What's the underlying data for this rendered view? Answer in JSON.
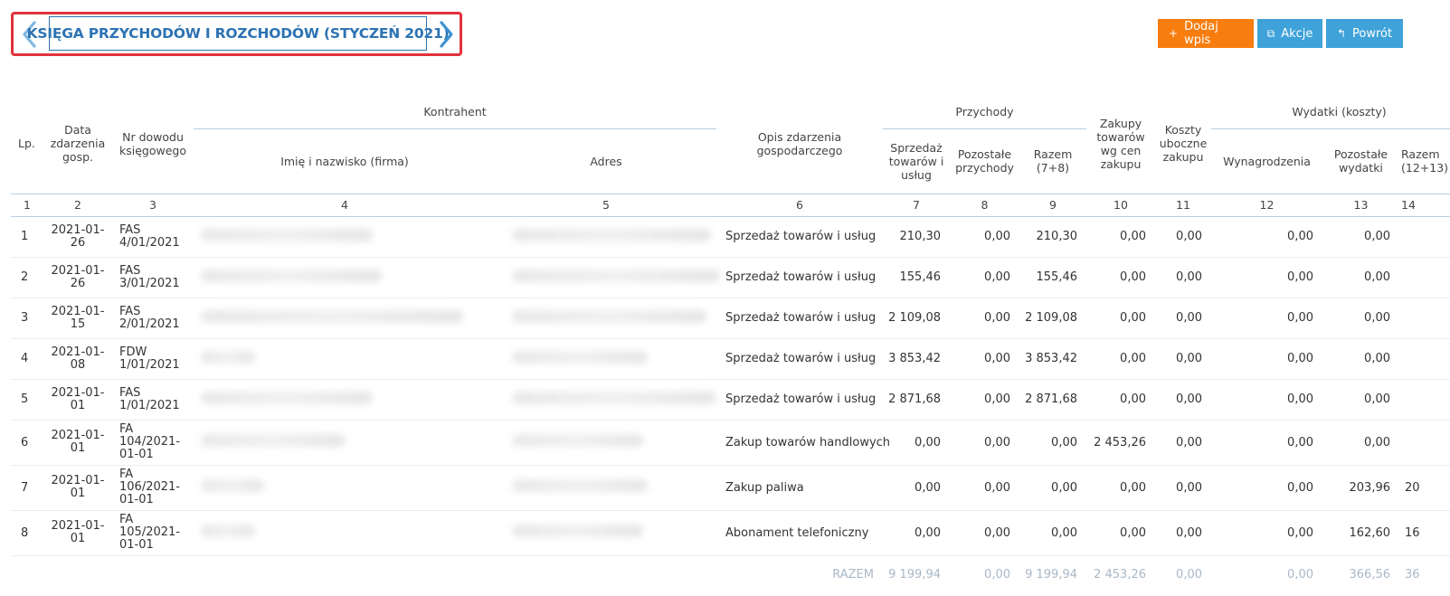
{
  "header": {
    "title": "KSIĘGA PRZYCHODÓW I ROZCHODÓW (STYCZEŃ 2021)",
    "prev_icon": "chevron-left-icon",
    "next_icon": "chevron-right-icon",
    "highlight_color": "#e2323c",
    "accent_color": "#2d73b3"
  },
  "toolbar": {
    "add_label": "Dodaj wpis",
    "actions_label": "Akcje",
    "back_label": "Powrót",
    "add_color": "#f77d0f",
    "secondary_color": "#3fa2d9"
  },
  "table": {
    "headers": {
      "lp": "Lp.",
      "date": "Data zdarzenia gosp.",
      "doc": "Nr dowodu księgowego",
      "contractor": "Kontrahent",
      "name": "Imię i nazwisko (firma)",
      "address": "Adres",
      "desc": "Opis zdarzenia gospodarczego",
      "income": "Przychody",
      "sales": "Sprzedaż towarów i usług",
      "other_income": "Pozostałe przychody",
      "total_income": "Razem (7+8)",
      "purchases": "Zakupy towarów wg cen zakupu",
      "side_costs": "Koszty uboczne zakupu",
      "expenses": "Wydatki (koszty)",
      "salaries": "Wynagrodzenia",
      "other_expenses": "Pozostałe wydatki",
      "total_expenses": "Razem (12+13)"
    },
    "column_numbers": [
      "1",
      "2",
      "3",
      "4",
      "5",
      "6",
      "7",
      "8",
      "9",
      "10",
      "11",
      "12",
      "13",
      "14"
    ],
    "rows": [
      {
        "lp": "1",
        "date": "2021-01-26",
        "doc": "FAS 4/01/2021",
        "desc": "Sprzedaż towarów i usług",
        "c7": "210,30",
        "c8": "0,00",
        "c9": "210,30",
        "c10": "0,00",
        "c11": "0,00",
        "c12": "0,00",
        "c13": "0,00",
        "c14": ""
      },
      {
        "lp": "2",
        "date": "2021-01-26",
        "doc": "FAS 3/01/2021",
        "desc": "Sprzedaż towarów i usług",
        "c7": "155,46",
        "c8": "0,00",
        "c9": "155,46",
        "c10": "0,00",
        "c11": "0,00",
        "c12": "0,00",
        "c13": "0,00",
        "c14": ""
      },
      {
        "lp": "3",
        "date": "2021-01-15",
        "doc": "FAS 2/01/2021",
        "desc": "Sprzedaż towarów i usług",
        "c7": "2 109,08",
        "c8": "0,00",
        "c9": "2 109,08",
        "c10": "0,00",
        "c11": "0,00",
        "c12": "0,00",
        "c13": "0,00",
        "c14": ""
      },
      {
        "lp": "4",
        "date": "2021-01-08",
        "doc": "FDW 1/01/2021",
        "desc": "Sprzedaż towarów i usług",
        "c7": "3 853,42",
        "c8": "0,00",
        "c9": "3 853,42",
        "c10": "0,00",
        "c11": "0,00",
        "c12": "0,00",
        "c13": "0,00",
        "c14": ""
      },
      {
        "lp": "5",
        "date": "2021-01-01",
        "doc": "FAS 1/01/2021",
        "desc": "Sprzedaż towarów i usług",
        "c7": "2 871,68",
        "c8": "0,00",
        "c9": "2 871,68",
        "c10": "0,00",
        "c11": "0,00",
        "c12": "0,00",
        "c13": "0,00",
        "c14": ""
      },
      {
        "lp": "6",
        "date": "2021-01-01",
        "doc": "FA 104/2021-01-01",
        "desc": "Zakup towarów handlowych",
        "c7": "0,00",
        "c8": "0,00",
        "c9": "0,00",
        "c10": "2 453,26",
        "c11": "0,00",
        "c12": "0,00",
        "c13": "0,00",
        "c14": ""
      },
      {
        "lp": "7",
        "date": "2021-01-01",
        "doc": "FA 106/2021-01-01",
        "desc": "Zakup paliwa",
        "c7": "0,00",
        "c8": "0,00",
        "c9": "0,00",
        "c10": "0,00",
        "c11": "0,00",
        "c12": "0,00",
        "c13": "203,96",
        "c14": "20"
      },
      {
        "lp": "8",
        "date": "2021-01-01",
        "doc": "FA 105/2021-01-01",
        "desc": "Abonament telefoniczny",
        "c7": "0,00",
        "c8": "0,00",
        "c9": "0,00",
        "c10": "0,00",
        "c11": "0,00",
        "c12": "0,00",
        "c13": "162,60",
        "c14": "16"
      }
    ],
    "totals": {
      "label": "RAZEM",
      "c7": "9 199,94",
      "c8": "0,00",
      "c9": "9 199,94",
      "c10": "2 453,26",
      "c11": "0,00",
      "c12": "0,00",
      "c13": "366,56",
      "c14": "36"
    }
  }
}
